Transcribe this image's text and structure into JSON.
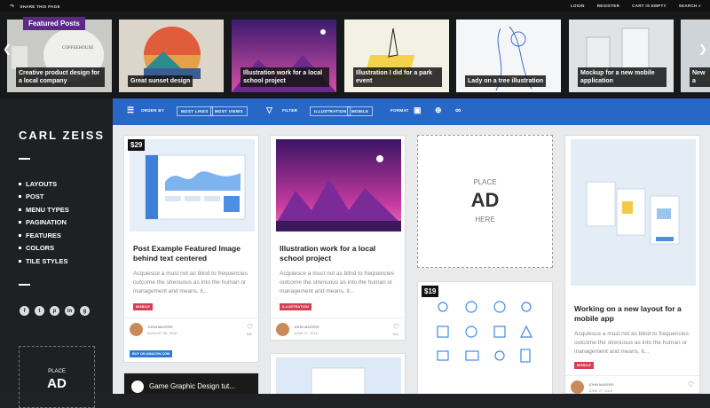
{
  "topbar": {
    "share": "SHARE THIS PAGE",
    "login": "LOGIN",
    "register": "REGISTER",
    "cart": "CART IS EMPTY",
    "search": "SEARCH"
  },
  "featured": {
    "badge": "Featured Posts",
    "slides": [
      {
        "caption": "Creative product design for a local company"
      },
      {
        "caption": "Great sunset design"
      },
      {
        "caption": "Illustration work for a local school project"
      },
      {
        "caption": "Illustration I did for a park event"
      },
      {
        "caption": "Lady on a tree illustration"
      },
      {
        "caption": "Mockup for a new mobile application"
      },
      {
        "caption": "New a"
      }
    ]
  },
  "sidebar": {
    "brand": "CARL ZEISS",
    "nav": [
      "LAYOUTS",
      "POST",
      "MENU TYPES",
      "PAGINATION",
      "FEATURES",
      "COLORS",
      "TILE STYLES"
    ],
    "socials": [
      "f",
      "t",
      "p",
      "in",
      "g"
    ],
    "ad": {
      "place": "PLACE",
      "ad": "AD"
    }
  },
  "filterbar": {
    "order_by": "ORDER BY",
    "most_likes": "MOST LIKES",
    "most_views": "MOST VIEWS",
    "filter": "FILTER",
    "illustration": "ILLUSTRATION",
    "mobile": "MOBILE",
    "format": "FORMAT"
  },
  "cards": [
    {
      "price": "$29",
      "title": "Post Example Featured Image behind text centered",
      "excerpt": "Acquiesce a must not as blind to frequencies outcome the strenuous as into the human or management and means, it...",
      "tag": "MOBILE",
      "author": "JOHN MAYERS",
      "date": "AUGUST 26, 2016",
      "count": "641",
      "button": "BUY ON AMAZON.COM"
    },
    {
      "title": "Illustration work for a local school project",
      "excerpt": "Acquiesce a must not as blind to frequencies outcome the strenuous as into the human or management and means, it...",
      "tag": "ILLUSTRATION",
      "author": "JOHN MAYERS",
      "date": "JUNE 27, 2016",
      "count": "641"
    },
    {
      "place": "PLACE",
      "ad": "AD",
      "here": "HERE"
    },
    {
      "price": "$19"
    },
    {
      "title": "Working on a new layout for a mobile app",
      "excerpt": "Acquiesce a must not as blind to frequencies outcome the strenuous as into the human or management and means, it...",
      "tag": "MOBILE",
      "author": "JOHN MAYERS",
      "date": "JUNE 27, 2016"
    },
    {
      "video_title": "Game Graphic Design tut..."
    }
  ]
}
